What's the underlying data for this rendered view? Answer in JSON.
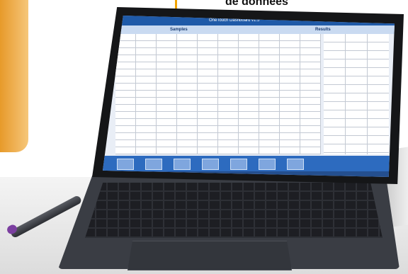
{
  "caption": {
    "text": "de données"
  },
  "app": {
    "title": "OneTouch Dashboard v1.5"
  },
  "screen": {
    "header_left": "Samples",
    "header_right": "Results"
  }
}
